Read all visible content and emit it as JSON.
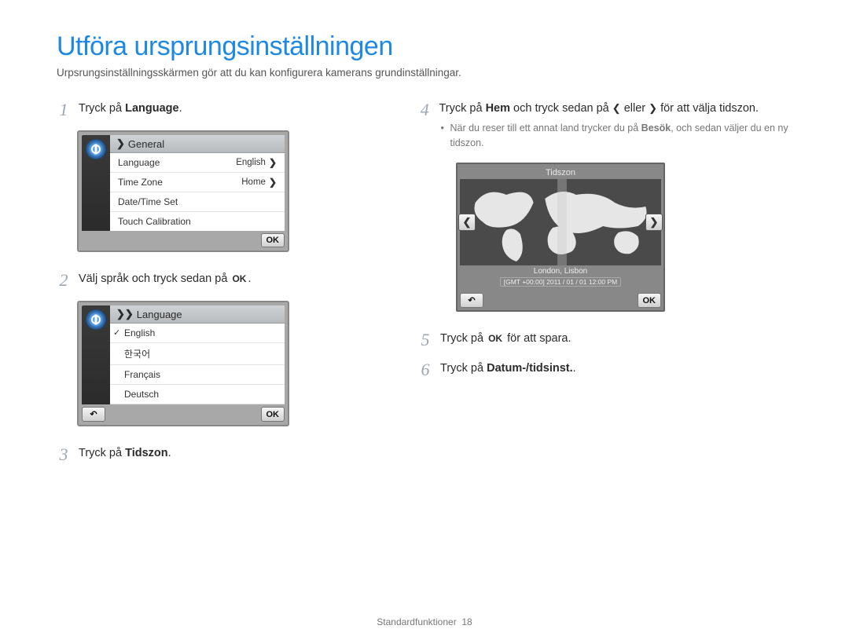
{
  "title": "Utföra ursprungsinställningen",
  "subtitle": "Urpsrungsinställningsskärmen gör att du kan konfigurera kamerans grundinställningar.",
  "steps": {
    "s1": {
      "num": "1",
      "pre": "Tryck på ",
      "bold": "Language",
      "post": "."
    },
    "s2": {
      "num": "2",
      "pre": "Välj språk och tryck sedan på ",
      "ok": "OK",
      "post": "."
    },
    "s3": {
      "num": "3",
      "pre": "Tryck på ",
      "bold": "Tidszon",
      "post": "."
    },
    "s4": {
      "num": "4",
      "pre": "Tryck på ",
      "bold1": "Hem",
      "mid": " och tryck sedan på ",
      "left": "❮",
      "or": " eller ",
      "right": "❯",
      "post": " för att välja tidszon."
    },
    "s4note": {
      "pre": "När du reser till ett annat land trycker du på ",
      "bold": "Besök",
      "post": ", och sedan väljer du en ny tidszon."
    },
    "s5": {
      "num": "5",
      "pre": "Tryck på ",
      "ok": "OK",
      "post": " för att spara."
    },
    "s6": {
      "num": "6",
      "pre": "Tryck på ",
      "bold": "Datum-/tidsinst.",
      "post": "."
    }
  },
  "panel1": {
    "header_marker": "❯",
    "header": "General",
    "rows": [
      {
        "label": "Language",
        "value": "English",
        "chev": "❯"
      },
      {
        "label": "Time Zone",
        "value": "Home",
        "chev": "❯"
      },
      {
        "label": "Date/Time Set",
        "value": ""
      },
      {
        "label": "Touch Calibration",
        "value": ""
      }
    ],
    "ok": "OK"
  },
  "panel2": {
    "header_marker": "❯❯",
    "header": "Language",
    "items": [
      {
        "label": "English",
        "checked": true
      },
      {
        "label": "한국어",
        "checked": false
      },
      {
        "label": "Français",
        "checked": false
      },
      {
        "label": "Deutsch",
        "checked": false
      }
    ],
    "back": "↶",
    "ok": "OK"
  },
  "tz": {
    "title": "Tidszon",
    "left": "❮",
    "right": "❯",
    "city": "London, Lisbon",
    "gmt": "[GMT +00:00]  2011 / 01 / 01  12:00 PM",
    "back": "↶",
    "ok": "OK"
  },
  "footer": {
    "label": "Standardfunktioner",
    "page": "18"
  }
}
